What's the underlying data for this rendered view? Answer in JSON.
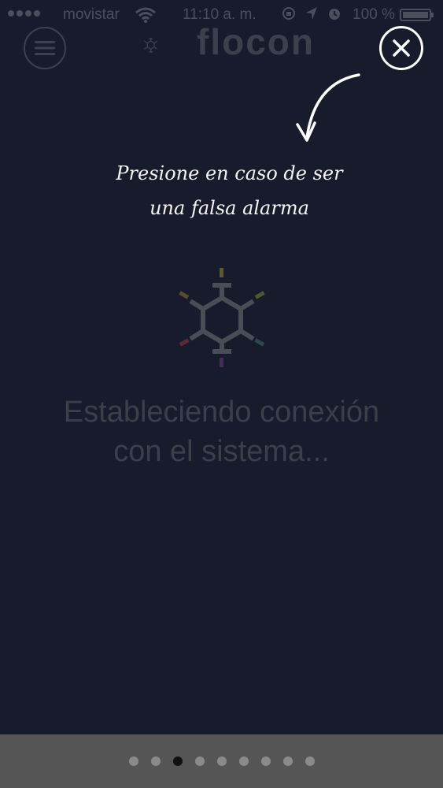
{
  "status_bar": {
    "carrier": "movistar",
    "time": "11:10 a. m.",
    "battery": "100 %",
    "icons": [
      "signal-dots-icon",
      "wifi-icon",
      "rotation-lock-icon",
      "location-arrow-icon",
      "alarm-icon",
      "battery-icon"
    ]
  },
  "header": {
    "menu_icon": "hamburger-menu-icon",
    "logo_text": "flocon",
    "close_icon": "close-icon"
  },
  "hint": {
    "line1": "Presione en caso de ser",
    "line2": "una falsa alarma"
  },
  "main": {
    "status_line1": "Estableciendo conexión",
    "status_line2": "con el sistema..."
  },
  "pager": {
    "count": 9,
    "active_index": 2
  },
  "colors": {
    "background": "#171b2c",
    "overlay_text": "#f4f4f4",
    "dim_text": "#3a3f4a",
    "bottom_bar": "#555555"
  }
}
